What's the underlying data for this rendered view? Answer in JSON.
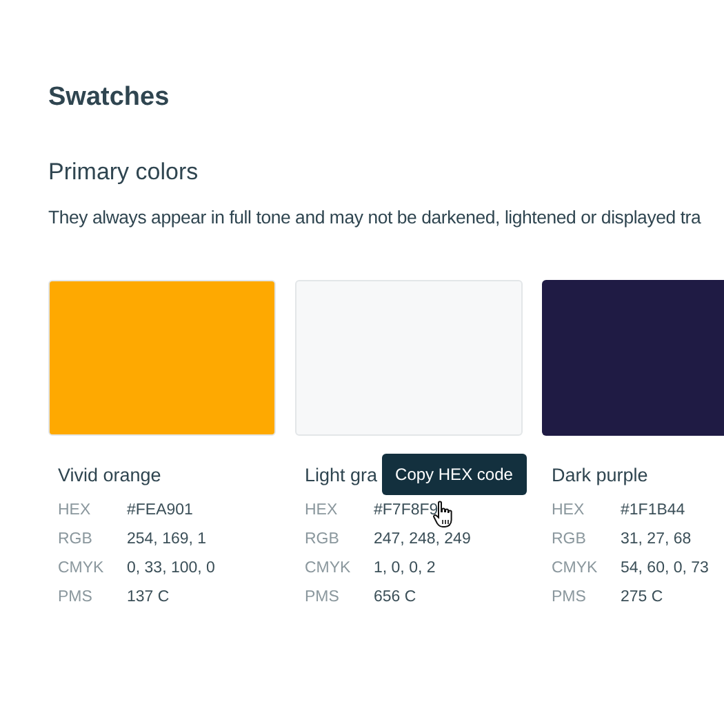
{
  "title": "Swatches",
  "section": {
    "heading": "Primary colors",
    "description": "They always appear in full tone and may not be darkened, lightened or displayed tra"
  },
  "swatches": [
    {
      "name": "Vivid orange",
      "color": "#fea901",
      "specs": [
        {
          "label": "HEX",
          "value": "#FEA901"
        },
        {
          "label": "RGB",
          "value": "254, 169, 1"
        },
        {
          "label": "CMYK",
          "value": "0, 33, 100, 0"
        },
        {
          "label": "PMS",
          "value": "137 C"
        }
      ]
    },
    {
      "name": "Light gra",
      "color": "#f7f8f9",
      "tooltip": "Copy HEX code",
      "specs": [
        {
          "label": "HEX",
          "value": "#F7F8F9"
        },
        {
          "label": "RGB",
          "value": "247, 248, 249"
        },
        {
          "label": "CMYK",
          "value": "1, 0, 0, 2"
        },
        {
          "label": "PMS",
          "value": "656 C"
        }
      ]
    },
    {
      "name": "Dark purple",
      "color": "#1f1b44",
      "specs": [
        {
          "label": "HEX",
          "value": "#1F1B44"
        },
        {
          "label": "RGB",
          "value": "31, 27, 68"
        },
        {
          "label": "CMYK",
          "value": "54, 60, 0, 73"
        },
        {
          "label": "PMS",
          "value": "275 C"
        }
      ]
    }
  ]
}
